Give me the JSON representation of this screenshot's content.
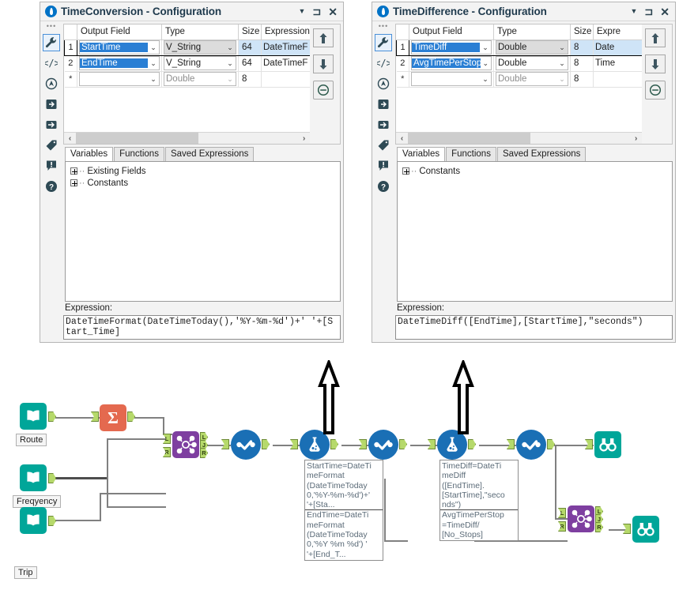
{
  "windows": [
    {
      "id": "left",
      "title_bold": "TimeConversion",
      "title_rest": " - Configuration",
      "grid": {
        "headers": [
          "",
          "Output Field",
          "Type",
          "Size",
          "Expression"
        ],
        "rows": [
          {
            "num": "1",
            "output_field": "StartTime",
            "type": "V_String",
            "size": "64",
            "expression": "DateTimeF",
            "selected": true
          },
          {
            "num": "2",
            "output_field": "EndTime",
            "type": "V_String",
            "size": "64",
            "expression": "DateTimeF",
            "selected": false
          },
          {
            "num": "*",
            "output_field": "",
            "type": "Double",
            "size": "8",
            "expression": "",
            "selected": false
          }
        ]
      },
      "tabs": [
        {
          "label": "Variables",
          "active": true
        },
        {
          "label": "Functions",
          "active": false
        },
        {
          "label": "Saved Expressions",
          "active": false
        }
      ],
      "tree": [
        "Existing Fields",
        "Constants"
      ],
      "expression_label": "Expression:",
      "expression": "DateTimeFormat(DateTimeToday(),'%Y-%m-%d')+' '+[Start_Time]"
    },
    {
      "id": "right",
      "title_bold": "TimeDifference",
      "title_rest": " - Configuration",
      "grid": {
        "headers": [
          "",
          "Output Field",
          "Type",
          "Size",
          "Expre"
        ],
        "rows": [
          {
            "num": "1",
            "output_field": "TimeDiff",
            "type": "Double",
            "size": "8",
            "expression": "Date",
            "selected": true
          },
          {
            "num": "2",
            "output_field": "AvgTimePerStop",
            "type": "Double",
            "size": "8",
            "expression": "Time",
            "selected": false
          },
          {
            "num": "*",
            "output_field": "",
            "type": "Double",
            "size": "8",
            "expression": "",
            "selected": false
          }
        ]
      },
      "tabs": [
        {
          "label": "Variables",
          "active": true
        },
        {
          "label": "Functions",
          "active": false
        },
        {
          "label": "Saved Expressions",
          "active": false
        }
      ],
      "tree": [
        "Constants"
      ],
      "expression_label": "Expression:",
      "expression": "DateTimeDiff([EndTime],[StartTime],\"seconds\")"
    }
  ],
  "rail": {
    "icons": [
      {
        "name": "wrench-icon",
        "selected": true
      },
      {
        "name": "code-icon",
        "selected": false
      },
      {
        "name": "compass-icon",
        "selected": false
      },
      {
        "name": "input-arrow-icon",
        "selected": false
      },
      {
        "name": "output-arrow-icon",
        "selected": false
      },
      {
        "name": "tag-icon",
        "selected": false
      },
      {
        "name": "warning-icon",
        "selected": false
      },
      {
        "name": "help-icon",
        "selected": false
      }
    ]
  },
  "grid_tools": [
    {
      "name": "move-up-button",
      "glyph": "up-arrow-icon"
    },
    {
      "name": "move-down-button",
      "glyph": "down-arrow-icon"
    },
    {
      "name": "remove-row-button",
      "glyph": "minus-circle-icon"
    }
  ],
  "titlebar_buttons": [
    {
      "name": "dropdown-caret-button",
      "glyph": "▼"
    },
    {
      "name": "pin-button",
      "glyph": "⯈"
    },
    {
      "name": "close-button",
      "glyph": "✕"
    }
  ],
  "canvas": {
    "node_labels": [
      {
        "name": "node-label-route",
        "text": "Route"
      },
      {
        "name": "node-label-freqyency",
        "text": "Freqyency"
      },
      {
        "name": "node-label-trip",
        "text": "Trip"
      }
    ],
    "annotations": [
      {
        "name": "annotation-timeconversion",
        "lines_top": [
          "StartTime=DateTi",
          "meFormat",
          "(DateTimeToday",
          "0,'%Y-%m-%d')+'",
          "'+[Sta..."
        ],
        "lines_bottom": [
          "EndTime=DateTi",
          "meFormat",
          "(DateTimeToday",
          "0,'%Y %m %d') '",
          "'+[End_T..."
        ]
      },
      {
        "name": "annotation-timedifference",
        "lines_top": [
          "TimeDiff=DateTi",
          "meDiff",
          "([EndTime].",
          "[StartTime],\"seco",
          "nds\")"
        ],
        "lines_bottom": [
          "AvgTimePerStop",
          "=TimeDiff/",
          "[No_Stops]"
        ]
      }
    ],
    "ports": {
      "join_left": "L",
      "join_right": "R",
      "join_out_l": "L",
      "join_out_j": "J",
      "join_out_r": "R"
    },
    "colors": {
      "input_tool": "#00a699",
      "summarize_tool": "#e4694f",
      "join_tool": "#7e3fa0",
      "select_formula_tool": "#1a6fb5",
      "browse_tool": "#00a699",
      "wire": "#808080",
      "port": "#b6d96b"
    }
  }
}
